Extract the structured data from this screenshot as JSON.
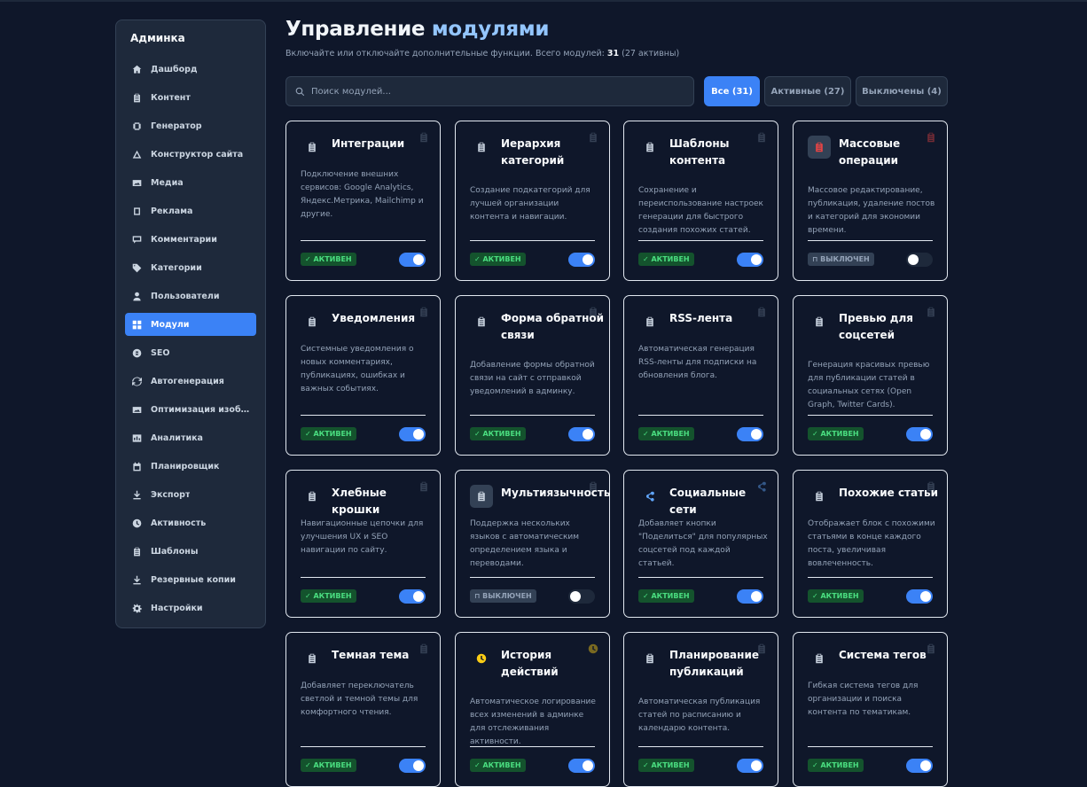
{
  "sidebar": {
    "title": "Админка",
    "items": [
      {
        "label": "Дашборд",
        "icon": "home-icon",
        "active": false
      },
      {
        "label": "Контент",
        "icon": "clipboard-icon",
        "active": false
      },
      {
        "label": "Генератор",
        "icon": "generator-icon",
        "active": false
      },
      {
        "label": "Конструктор сайта",
        "icon": "builder-icon",
        "active": false
      },
      {
        "label": "Медиа",
        "icon": "image-icon",
        "active": false
      },
      {
        "label": "Реклама",
        "icon": "ads-icon",
        "active": false
      },
      {
        "label": "Комментарии",
        "icon": "comment-icon",
        "active": false
      },
      {
        "label": "Категории",
        "icon": "tag-icon",
        "active": false
      },
      {
        "label": "Пользователи",
        "icon": "user-icon",
        "active": false
      },
      {
        "label": "Модули",
        "icon": "grid-icon",
        "active": true
      },
      {
        "label": "SEO",
        "icon": "seo-icon",
        "active": false
      },
      {
        "label": "Автогенерация",
        "icon": "refresh-icon",
        "active": false
      },
      {
        "label": "Оптимизация изобра...",
        "icon": "image-icon",
        "active": false
      },
      {
        "label": "Аналитика",
        "icon": "analytics-icon",
        "active": false
      },
      {
        "label": "Планировщик",
        "icon": "calendar-icon",
        "active": false
      },
      {
        "label": "Экспорт",
        "icon": "download-icon",
        "active": false
      },
      {
        "label": "Активность",
        "icon": "clock-icon",
        "active": false
      },
      {
        "label": "Шаблоны",
        "icon": "clipboard-icon",
        "active": false
      },
      {
        "label": "Резервные копии",
        "icon": "download-icon",
        "active": false
      },
      {
        "label": "Настройки",
        "icon": "gear-icon",
        "active": false
      }
    ]
  },
  "header": {
    "title_main": "Управление ",
    "title_accent": "модулями",
    "subtitle_prefix": "Включайте или отключайте дополнительные функции. Всего модулей: ",
    "total": "31",
    "subtitle_suffix": " (27 активны)"
  },
  "search": {
    "placeholder": "Поиск модулей..."
  },
  "filters": [
    {
      "label": "Все (31)",
      "active": true
    },
    {
      "label": "Активные (27)",
      "active": false
    },
    {
      "label": "Выключены (4)",
      "active": false
    }
  ],
  "status_labels": {
    "on": "✓ АКТИВЕН",
    "off": "⊓ ВЫКЛЮЧЕН"
  },
  "colors": {
    "accent": "#3b82f6",
    "active_badge": "#4ade80",
    "background": "#0f172a"
  },
  "modules": [
    {
      "title": "Интеграции",
      "desc": "Подключение внешних сервисов: Google Analytics, Яндекс.Метрика, Mailchimp и другие.",
      "active": true,
      "icon": "clipboard-icon"
    },
    {
      "title": "Иерархия категорий",
      "desc": "Создание подкатегорий для лучшей организации контента и навигации.",
      "active": true,
      "icon": "clipboard-icon"
    },
    {
      "title": "Шаблоны контента",
      "desc": "Сохранение и переиспользование настроек генерации для быстрого создания похожих статей.",
      "active": true,
      "icon": "clipboard-icon"
    },
    {
      "title": "Массовые операции",
      "desc": "Массовое редактирование, публикация, удаление постов и категорий для экономии времени.",
      "active": false,
      "icon": "clipboard-red-icon"
    },
    {
      "title": "Уведомления",
      "desc": "Системные уведомления о новых комментариях, публикациях, ошибках и важных событиях.",
      "active": true,
      "icon": "clipboard-icon"
    },
    {
      "title": "Форма обратной связи",
      "desc": "Добавление формы обратной связи на сайт с отправкой уведомлений в админку.",
      "active": true,
      "icon": "clipboard-icon"
    },
    {
      "title": "RSS-лента",
      "desc": "Автоматическая генерация RSS-ленты для подписки на обновления блога.",
      "active": true,
      "icon": "clipboard-icon"
    },
    {
      "title": "Превью для соцсетей",
      "desc": "Генерация красивых превью для публикации статей в социальных сетях (Open Graph, Twitter Cards).",
      "active": true,
      "icon": "clipboard-icon"
    },
    {
      "title": "Хлебные крошки",
      "desc": "Навигационные цепочки для улучшения UX и SEO навигации по сайту.",
      "active": true,
      "icon": "clipboard-icon"
    },
    {
      "title": "Мультиязычность",
      "desc": "Поддержка нескольких языков с автоматическим определением языка и переводами.",
      "active": false,
      "icon": "clipboard-icon"
    },
    {
      "title": "Социальные сети",
      "desc": "Добавляет кнопки \"Поделиться\" для популярных соцсетей под каждой статьей.",
      "active": true,
      "icon": "share-icon"
    },
    {
      "title": "Похожие статьи",
      "desc": "Отображает блок с похожими статьями в конце каждого поста, увеличивая вовлеченность.",
      "active": true,
      "icon": "clipboard-icon"
    },
    {
      "title": "Темная тема",
      "desc": "Добавляет переключатель светлой и темной темы для комфортного чтения.",
      "active": true,
      "icon": "clipboard-icon"
    },
    {
      "title": "История действий",
      "desc": "Автоматическое логирование всех изменений в админке для отслеживания активности.",
      "active": true,
      "icon": "clock-icon"
    },
    {
      "title": "Планирование публикаций",
      "desc": "Автоматическая публикация статей по расписанию и календарю контента.",
      "active": true,
      "icon": "clipboard-icon"
    },
    {
      "title": "Система тегов",
      "desc": "Гибкая система тегов для организации и поиска контента по тематикам.",
      "active": true,
      "icon": "clipboard-icon"
    }
  ]
}
